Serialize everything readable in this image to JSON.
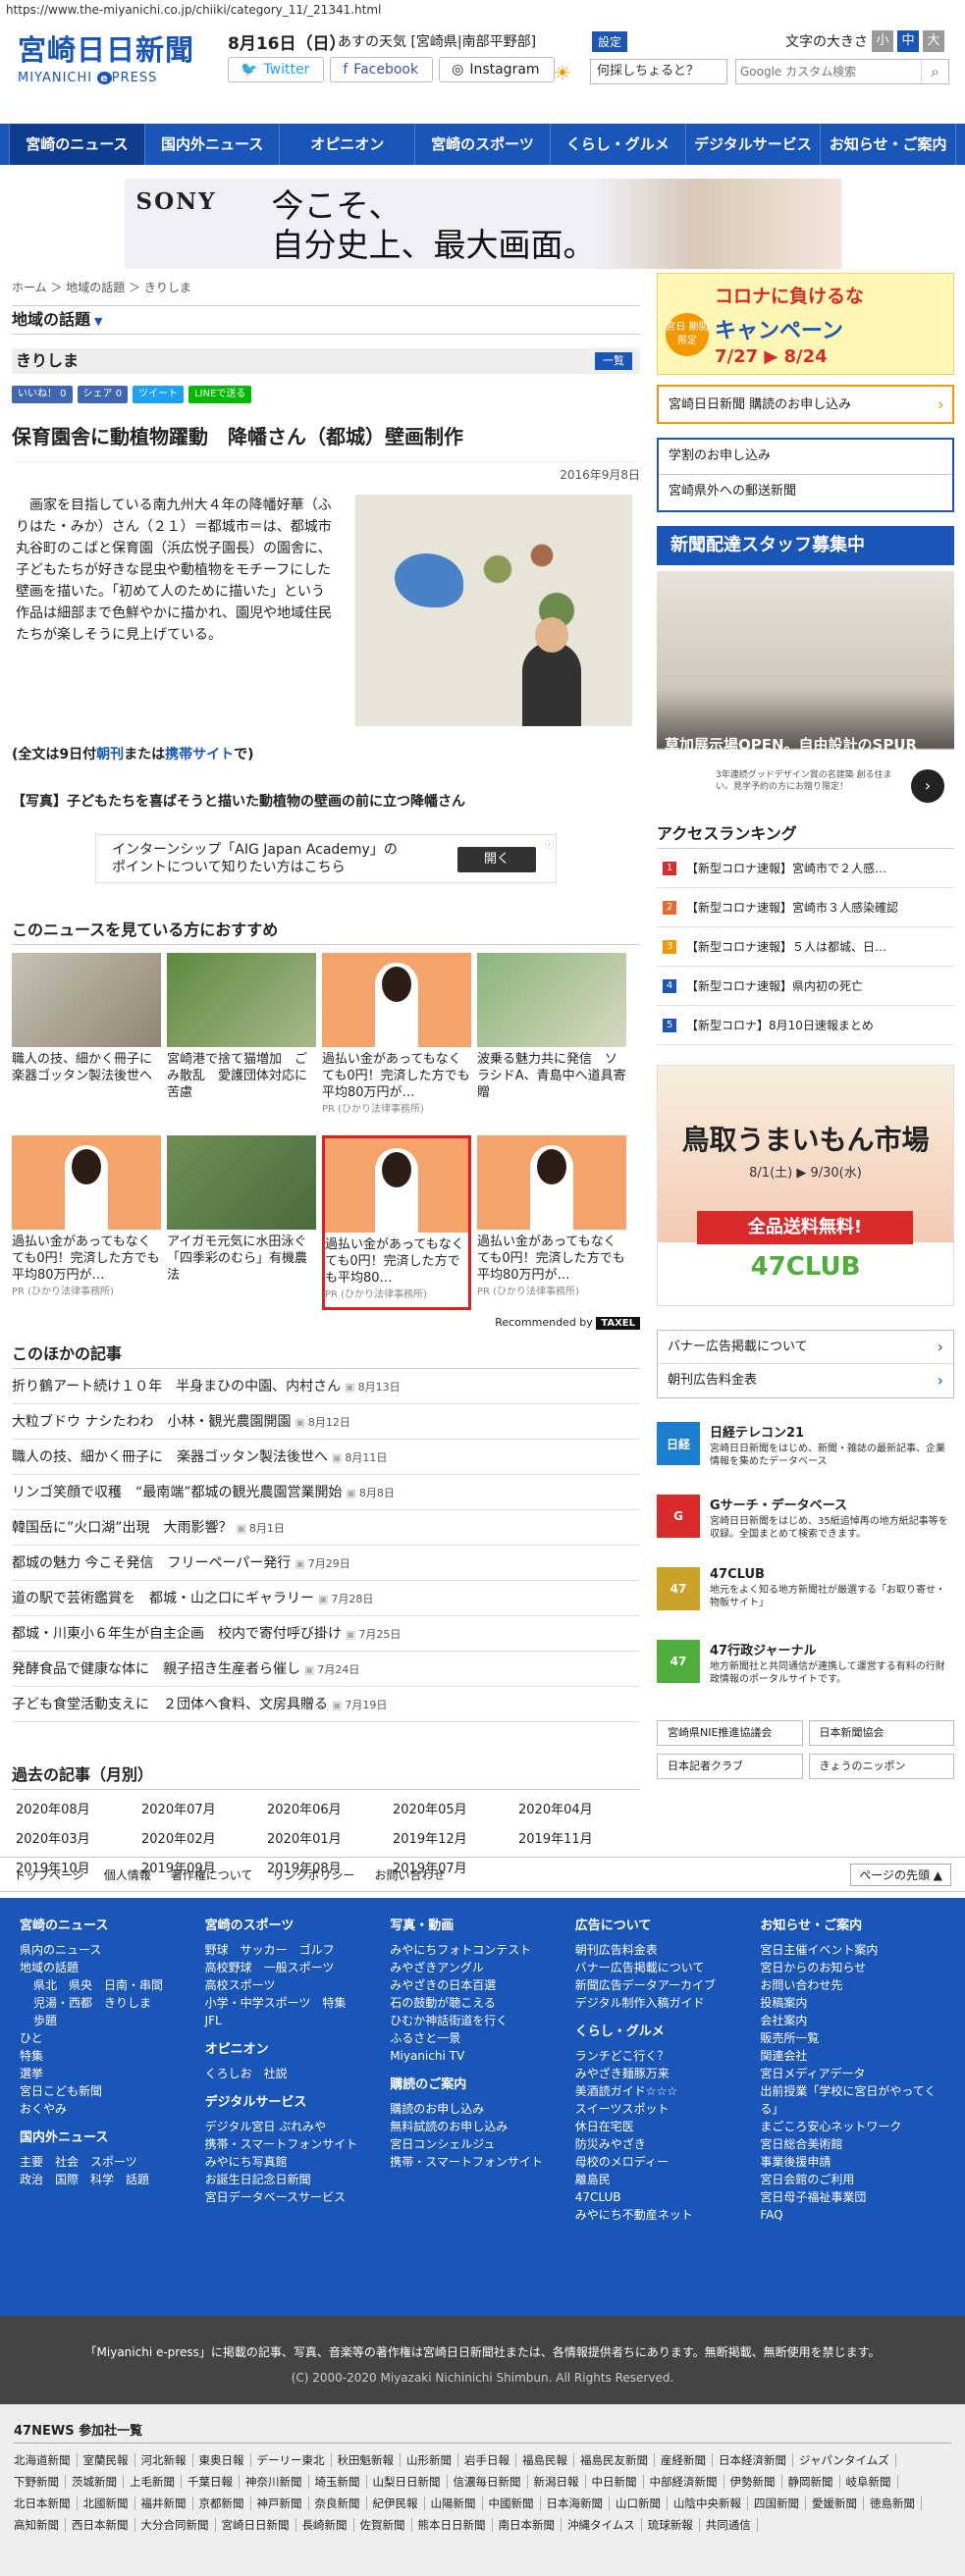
{
  "url": "https://www.the-miyanichi.co.jp/chiiki/category_11/_21341.html",
  "header": {
    "logo_title": "宮崎日日新聞",
    "logo_sub_left": "MIYANICHI",
    "logo_sub_e": "e",
    "logo_sub_right": "PRESS",
    "date": "8月16日（日）",
    "weather": "あすの天気 [宮崎県|南部平野部]",
    "settei": "設定",
    "fontsize_label": "文字の大きさ",
    "fontsize": [
      "小",
      "中",
      "大"
    ],
    "twitter": "Twitter",
    "facebook": "Facebook",
    "instagram": "Instagram",
    "ask": "何採しちょると？",
    "search_placeholder": "Google カスタム検索"
  },
  "nav": [
    "宮崎のニュース",
    "国内外ニュース",
    "オピニオン",
    "宮崎のスポーツ",
    "くらし・グルメ",
    "デジタルサービス",
    "お知らせ・ご案内"
  ],
  "banner": {
    "brand": "SONY",
    "line1": "今こそ、",
    "line2": "自分史上、最大画面。"
  },
  "breadcrumb": "ホーム ＞ 地域の話題 ＞ きりしま",
  "section_title": "地域の話題",
  "category": {
    "name": "きりしま",
    "ichiran": "一覧"
  },
  "share": [
    "いいね！ 0",
    "シェア 0",
    "ツイート",
    "LINEで送る"
  ],
  "article": {
    "title": "保育園舎に動植物躍動　降幡さん（都城）壁画制作",
    "date": "2016年9月8日",
    "body": "画家を目指している南九州大４年の降幡好華（ふりはた・みか）さん（２１）＝都城市＝は、都城市丸谷町のこばと保育園（浜広悦子園長）の園舎に、子どもたちが好きな昆虫や動植物をモチーフにした壁画を描いた。「初めて人のために描いた」という作品は細部まで色鮮やかに描かれ、園児や地域住民たちが楽しそうに見上げている。",
    "full_pre": "(全文は9日付",
    "full_link1": "朝刊",
    "full_mid": "または",
    "full_link2": "携帯サイト",
    "full_post": "で)",
    "caption": "【写真】子どもたちを喜ばそうと描いた動植物の壁画の前に立つ降幡さん"
  },
  "ad_intern": {
    "text1": "インターンシップ「AIG Japan Academy」の",
    "text2": "ポイントについて知りたい方はこちら",
    "button": "開く"
  },
  "reco": {
    "title": "このニュースを見ている方におすすめ",
    "items": [
      {
        "title": "職人の技、細かく冊子に　楽器ゴッタン製法後世へ",
        "pr": ""
      },
      {
        "title": "宮崎港で捨て猫増加　ごみ散乱　愛護団体対応に苦慮",
        "pr": ""
      },
      {
        "title": "過払い金があってもなくても0円！完済した方でも平均80万円が…",
        "pr": "PR (ひかり法律事務所)"
      },
      {
        "title": "波乗る魅力共に発信　ソラシドA、青島中へ道具寄贈",
        "pr": ""
      },
      {
        "title": "過払い金があってもなくても0円！完済した方でも平均80万円が…",
        "pr": "PR (ひかり法律事務所)"
      },
      {
        "title": "アイガモ元気に水田泳ぐ　「四季彩のむら」有機農法",
        "pr": ""
      },
      {
        "title": "過払い金があってもなくても0円！完済した方でも平均80…",
        "pr": "PR (ひかり法律事務所)"
      },
      {
        "title": "過払い金があってもなくても0円！完済した方でも平均80万円が…",
        "pr": "PR (ひかり法律事務所)"
      }
    ],
    "recommended_by": "Recommended by",
    "provider": "TAXEL"
  },
  "other": {
    "title": "このほかの記事",
    "items": [
      {
        "t": "折り鶴アート続け１０年　半身まひの中園、内村さん",
        "d": "8月13日"
      },
      {
        "t": "大粒ブドウ ナシたわわ　小林・観光農園開園",
        "d": "8月12日"
      },
      {
        "t": "職人の技、細かく冊子に　楽器ゴッタン製法後世へ",
        "d": "8月11日"
      },
      {
        "t": "リンゴ笑顔で収穫　“最南端”都城の観光農園営業開始",
        "d": "8月8日"
      },
      {
        "t": "韓国岳に”火口湖”出現　大雨影響？",
        "d": "8月1日"
      },
      {
        "t": "都城の魅力 今こそ発信　フリーペーパー発行",
        "d": "7月29日"
      },
      {
        "t": "道の駅で芸術鑑賞を　都城・山之口にギャラリー",
        "d": "7月28日"
      },
      {
        "t": "都城・川東小６年生が自主企画　校内で寄付呼び掛け",
        "d": "7月25日"
      },
      {
        "t": "発酵食品で健康な体に　親子招き生産者ら催し",
        "d": "7月24日"
      },
      {
        "t": "子ども食堂活動支えに　２団体へ食料、文房具贈る",
        "d": "7月19日"
      }
    ]
  },
  "past": {
    "title": "過去の記事（月別）",
    "months": [
      "2020年08月",
      "2020年07月",
      "2020年06月",
      "2020年05月",
      "2020年04月",
      "2020年03月",
      "2020年02月",
      "2020年01月",
      "2019年12月",
      "2019年11月",
      "2019年10月",
      "2019年09月",
      "2019年08月",
      "2019年07月"
    ]
  },
  "sidebar": {
    "corona": {
      "t1": "コロナに負けるな",
      "t2": "キャンペーン",
      "t3": "7/27 ▶ 8/24",
      "badge": "宮日 期間限定"
    },
    "subscribe": "宮崎日日新聞 購読のお申し込み",
    "gakuwari": "学割のお申し込み",
    "yuso": "宮崎県外への郵送新聞",
    "staff": "新聞配達スタッフ募集中",
    "spur": {
      "caption": "草加展示場OPEN。自由設計のSPUR",
      "small": "3年連続グッドデザイン賞の名建築 創る住まい。見学予約の方にお贈り限定！"
    },
    "ranking_title": "アクセスランキング",
    "ranking": [
      {
        "n": "1",
        "t": "【新型コロナ速報】宮崎市で２人感…",
        "c": "#d92b2b"
      },
      {
        "n": "2",
        "t": "【新型コロナ速報】宮崎市３人感染確認",
        "c": "#e8692b"
      },
      {
        "n": "3",
        "t": "【新型コロナ速報】５人は都城、日…",
        "c": "#f39800"
      },
      {
        "n": "4",
        "t": "【新型コロナ速報】県内初の死亡",
        "c": "#1a56b8"
      },
      {
        "n": "5",
        "t": "【新型コロナ】8月10日速報まとめ",
        "c": "#1a56b8"
      }
    ],
    "tottori": {
      "title": "鳥取うまいもん市場",
      "date": "8/1(土) ▶ 9/30(水)",
      "free": "全品送料無料!",
      "club": "47CLUB"
    },
    "links": [
      "バナー広告掲載について",
      "朝刊広告料金表"
    ],
    "services": [
      {
        "ic": "日経",
        "name": "日経テレコン21",
        "desc": "宮崎日日新聞をはじめ、新聞・雑誌の最新記事、企業情報を集めたデータベース",
        "color": "#1a7fd0"
      },
      {
        "ic": "G",
        "name": "Gサーチ・データベース",
        "desc": "宮崎日日新聞をはじめ、35紙追悼再の地方紙記事等を収録。全国まとめて検索できます。",
        "color": "#d92b2b"
      },
      {
        "ic": "47",
        "name": "47CLUB",
        "desc": "地元をよく知る地方新聞社が厳選する「お取り寄せ・物販サイト」",
        "color": "#c9a227"
      },
      {
        "ic": "47",
        "name": "47行政ジャーナル",
        "desc": "地方新聞社と共同通信が連携して運営する有料の行財政情報のポータルサイトです。",
        "color": "#4fae3b"
      }
    ],
    "clubs": [
      "宮崎県NIE推進協議会",
      "日本新聞協会",
      "日本記者クラブ",
      "きょうのニッポン"
    ]
  },
  "foot_links": [
    "トップページ",
    "個人情報",
    "著作権について",
    "リンクポリシー",
    "お問い合わせ"
  ],
  "to_top": "ページの先頭 ▲",
  "footer": {
    "col1": {
      "h": "宮崎のニュース",
      "items": [
        "県内のニュース",
        "地域の話題"
      ],
      "sub": [
        "県北　県央　日南・串間",
        "児湯・西都　きりしま",
        "歩題"
      ],
      "items2": [
        "ひと",
        "特集",
        "選挙",
        "宮日こども新聞",
        "おくやみ"
      ],
      "h2": "国内外ニュース",
      "items3": [
        "主要　社会　スポーツ",
        "政治　国際　科学　話題"
      ]
    },
    "col2": {
      "h": "宮崎のスポーツ",
      "items": [
        "野球　サッカー　ゴルフ",
        "高校野球　一般スポーツ",
        "高校スポーツ",
        "小学・中学スポーツ　特集",
        "JFL"
      ],
      "h2": "オピニオン",
      "items2": [
        "くろしお　社説"
      ],
      "h3": "デジタルサービス",
      "items3": [
        "デジタル宮日 ぷれみや",
        "携帯・スマートフォンサイト",
        "みやにち写真館",
        "お誕生日記念日新聞",
        "宮日データベースサービス"
      ]
    },
    "col3": {
      "h": "写真・動画",
      "items": [
        "みやにちフォトコンテスト",
        "みやざきアングル",
        "みやざきの日本百選",
        "石の鼓動が聴こえる",
        "ひむか神話街道を行く",
        "ふるさと一景",
        "Miyanichi TV"
      ],
      "h2": "購読のご案内",
      "items2": [
        "購読のお申し込み",
        "無料試読のお申し込み",
        "宮日コンシェルジュ",
        "携帯・スマートフォンサイト"
      ]
    },
    "col4": {
      "h": "広告について",
      "items": [
        "朝刊広告料金表",
        "バナー広告掲載について",
        "新聞広告データアーカイブ",
        "デジタル制作入稿ガイド"
      ],
      "h2": "くらし・グルメ",
      "items2": [
        "ランチどこ行く？",
        "みやざき麺豚万来",
        "美酒読ガイド☆☆☆",
        "スイーツスポット",
        "休日在宅医",
        "防災みやざき",
        "母校のメロディー",
        "離島民",
        "47CLUB",
        "みやにち不動産ネット"
      ]
    },
    "col5": {
      "h": "お知らせ・ご案内",
      "items": [
        "宮日主催イベント案内",
        "宮日からのお知らせ",
        "お問い合わせ先",
        "投稿案内",
        "会社案内",
        "販売所一覧",
        "関連会社",
        "宮日メディアデータ",
        "出前授業「学校に宮日がやってくる」",
        "まごころ安心ネットワーク",
        "宮日総合美術館",
        "事業後援申請",
        "宮日会館のご利用",
        "宮日母子福祉事業団",
        "FAQ"
      ]
    }
  },
  "copyright": {
    "line1": "「Miyanichi e-press」に掲載の記事、写真、音楽等の著作権は宮崎日日新聞社または、各情報提供者ちにあります。無断掲載、無断使用を禁じます。",
    "line2": "(C) 2000-2020 Miyazaki Nichinichi Shimbun. All Rights Reserved."
  },
  "news47": {
    "title": "47NEWS 参加社一覧",
    "papers": [
      "北海道新聞",
      "室蘭民報",
      "河北新報",
      "東奥日報",
      "デーリー東北",
      "秋田魁新報",
      "山形新聞",
      "岩手日報",
      "福島民報",
      "福島民友新聞",
      "産経新聞",
      "日本経済新聞",
      "ジャパンタイムズ",
      "下野新聞",
      "茨城新聞",
      "上毛新聞",
      "千葉日報",
      "神奈川新聞",
      "埼玉新聞",
      "山梨日日新聞",
      "信濃毎日新聞",
      "新潟日報",
      "中日新聞",
      "中部経済新聞",
      "伊勢新聞",
      "静岡新聞",
      "岐阜新聞",
      "北日本新聞",
      "北國新聞",
      "福井新聞",
      "京都新聞",
      "神戸新聞",
      "奈良新聞",
      "紀伊民報",
      "山陽新聞",
      "中國新聞",
      "日本海新聞",
      "山口新聞",
      "山陰中央新報",
      "四国新聞",
      "愛媛新聞",
      "徳島新聞",
      "高知新聞",
      "西日本新聞",
      "大分合同新聞",
      "宮崎日日新聞",
      "長崎新聞",
      "佐賀新聞",
      "熊本日日新聞",
      "南日本新聞",
      "沖縄タイムス",
      "琉球新報",
      "共同通信"
    ]
  }
}
